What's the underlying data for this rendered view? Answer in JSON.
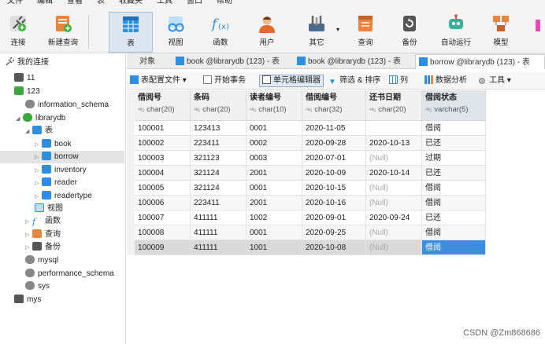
{
  "menu": [
    "文件",
    "编辑",
    "查看",
    "表",
    "收藏夹",
    "工具",
    "窗口",
    "帮助"
  ],
  "toolbar": {
    "connect": "连接",
    "new_query": "新建查询",
    "table": "表",
    "view": "视图",
    "function": "函数",
    "user": "用户",
    "other": "其它",
    "query": "查询",
    "backup": "备份",
    "automation": "自动运行",
    "model": "模型"
  },
  "tree": {
    "my_connections": "我的连接",
    "conn_11": "11",
    "conn_123": "123",
    "information_schema": "information_schema",
    "librarydb": "librarydb",
    "tables_folder": "表",
    "tables": [
      "book",
      "borrow",
      "inventory",
      "reader",
      "readertype"
    ],
    "views": "视图",
    "functions": "函数",
    "queries": "查询",
    "backups": "备份",
    "mysql": "mysql",
    "performance_schema": "performance_schema",
    "sys": "sys",
    "mys": "mys"
  },
  "tabs": {
    "objects": "对象",
    "tab1": "book @librarydb (123) - 表",
    "tab2": "book @librarydb (123) - 表",
    "tab3": "borrow @librarydb (123) - 表"
  },
  "subtoolbar": {
    "table_config": "表配置文件",
    "begin_transaction": "开始事务",
    "cell_editor": "单元格编辑器",
    "filter_sort": "筛选 & 排序",
    "columns": "列",
    "data_analysis": "数据分析",
    "tools": "工具"
  },
  "grid": {
    "columns": [
      {
        "name": "借阅号",
        "type": "char(20)"
      },
      {
        "name": "条码",
        "type": "char(20)"
      },
      {
        "name": "读者编号",
        "type": "char(10)"
      },
      {
        "name": "借阅编号",
        "type": "char(32)"
      },
      {
        "name": "还书日期",
        "type": "char(20)"
      },
      {
        "name": "借阅状态",
        "type": "varchar(5)"
      }
    ],
    "rows": [
      [
        "100001",
        "123413",
        "0001",
        "2020-11-05",
        "",
        "借阅"
      ],
      [
        "100002",
        "223411",
        "0002",
        "2020-09-28",
        "2020-10-13",
        "已还"
      ],
      [
        "100003",
        "321123",
        "0003",
        "2020-07-01",
        "(Null)",
        "过期"
      ],
      [
        "100004",
        "321124",
        "2001",
        "2020-10-09",
        "2020-10-14",
        "已还"
      ],
      [
        "100005",
        "321124",
        "0001",
        "2020-10-15",
        "(Null)",
        "借阅"
      ],
      [
        "100006",
        "223411",
        "2001",
        "2020-10-16",
        "(Null)",
        "借阅"
      ],
      [
        "100007",
        "411111",
        "1002",
        "2020-09-01",
        "2020-09-24",
        "已还"
      ],
      [
        "100008",
        "411111",
        "0001",
        "2020-09-25",
        "(Null)",
        "借阅"
      ],
      [
        "100009",
        "411111",
        "1001",
        "2020-10-08",
        "(Null)",
        "借阅"
      ]
    ]
  },
  "watermark": "CSDN @Zm868686"
}
